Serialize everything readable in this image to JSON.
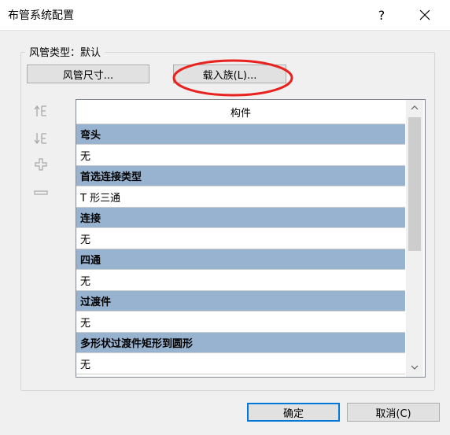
{
  "window": {
    "title": "布管系统配置",
    "help_label": "?",
    "close_icon": "close-icon"
  },
  "group": {
    "label": "风管类型：默认"
  },
  "buttons": {
    "duct_size": "风管尺寸...",
    "load_family": "载入族(L)...",
    "ok": "确定",
    "cancel": "取消(C)"
  },
  "side_icons": [
    "move-up-icon",
    "move-down-icon",
    "add-icon",
    "remove-icon"
  ],
  "list": {
    "header": "构件",
    "rows": [
      {
        "category": "弯头",
        "value": "无"
      },
      {
        "category": "首选连接类型",
        "value": "T 形三通"
      },
      {
        "category": "连接",
        "value": "无"
      },
      {
        "category": "四通",
        "value": "无"
      },
      {
        "category": "过渡件",
        "value": "无"
      },
      {
        "category": "多形状过渡件矩形到圆形",
        "value": "无"
      }
    ]
  },
  "colors": {
    "category_row": "#98b3d0",
    "annotation_ellipse": "#e8231f",
    "default_button_border": "#0078d7"
  }
}
